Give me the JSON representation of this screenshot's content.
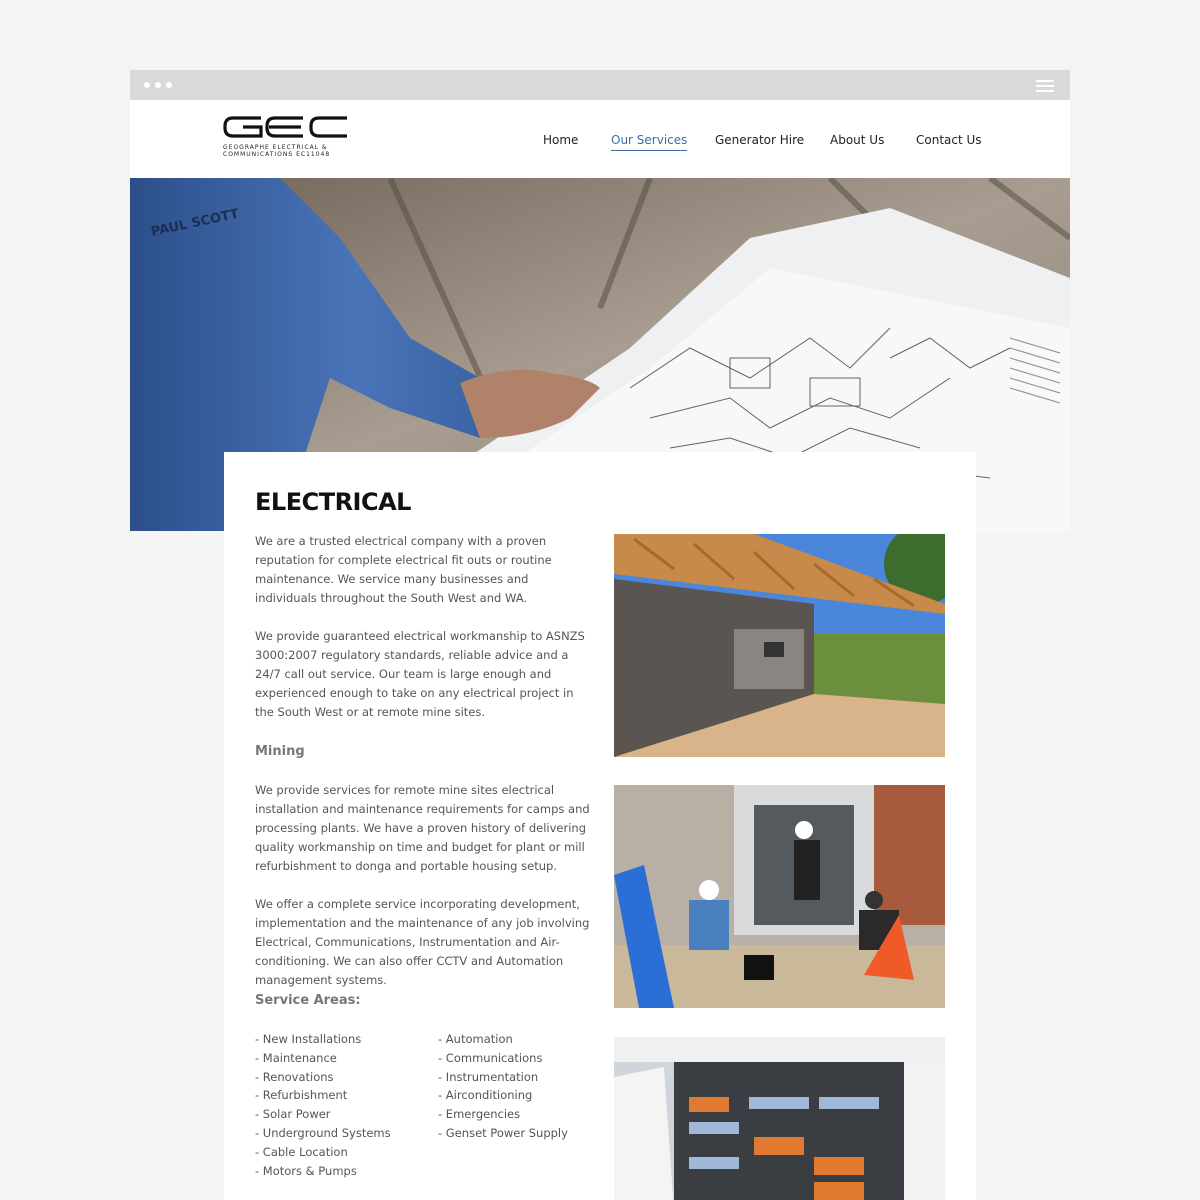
{
  "nav": {
    "items": [
      {
        "label": "Home",
        "active": false
      },
      {
        "label": "Our Services",
        "active": true
      },
      {
        "label": "Generator Hire",
        "active": false
      },
      {
        "label": "About Us",
        "active": false
      },
      {
        "label": "Contact Us",
        "active": false
      }
    ]
  },
  "logo": {
    "text": "GEC",
    "subtitle_line1": "GEOGRAPHE ELECTRICAL &",
    "subtitle_line2": "COMMUNICATIONS EC11048"
  },
  "hero": {
    "badge_name": "PAUL SCOTT"
  },
  "page": {
    "title": "ELECTRICAL",
    "para1": "We are a trusted electrical company with a proven reputation for complete electrical fit outs or routine maintenance. We service many businesses and individuals throughout the South West and WA.",
    "para2": "We provide guaranteed electrical workmanship to ASNZS 3000:2007 regulatory standards, reliable advice and a 24/7 call out service. Our team is large enough and experienced enough to take on any electrical project in the South West or at remote mine sites.",
    "mining_heading": "Mining",
    "para3": "We provide services for remote mine sites electrical installation and maintenance requirements for camps and processing plants. We have a proven history of delivering quality workmanship on time and budget for plant or mill refurbishment to donga and portable housing setup.",
    "para4": "We offer a complete service incorporating development, implementation and the maintenance of any job involving Electrical, Communications, Instrumentation and Air-conditioning. We can also offer CCTV and Automation management systems.",
    "service_areas_heading": "Service Areas:",
    "services_left": [
      "- New Installations",
      "- Maintenance",
      "- Renovations",
      "- Refurbishment",
      "- Solar Power",
      "- Underground Systems",
      "- Cable Location",
      "- Motors & Pumps"
    ],
    "services_right": [
      "- Automation",
      "- Communications",
      "- Instrumentation",
      "- Airconditioning",
      "- Emergencies",
      "- Genset Power Supply"
    ]
  },
  "colors": {
    "accent": "#3a6ea5",
    "text": "#555555",
    "heading": "#111111"
  }
}
